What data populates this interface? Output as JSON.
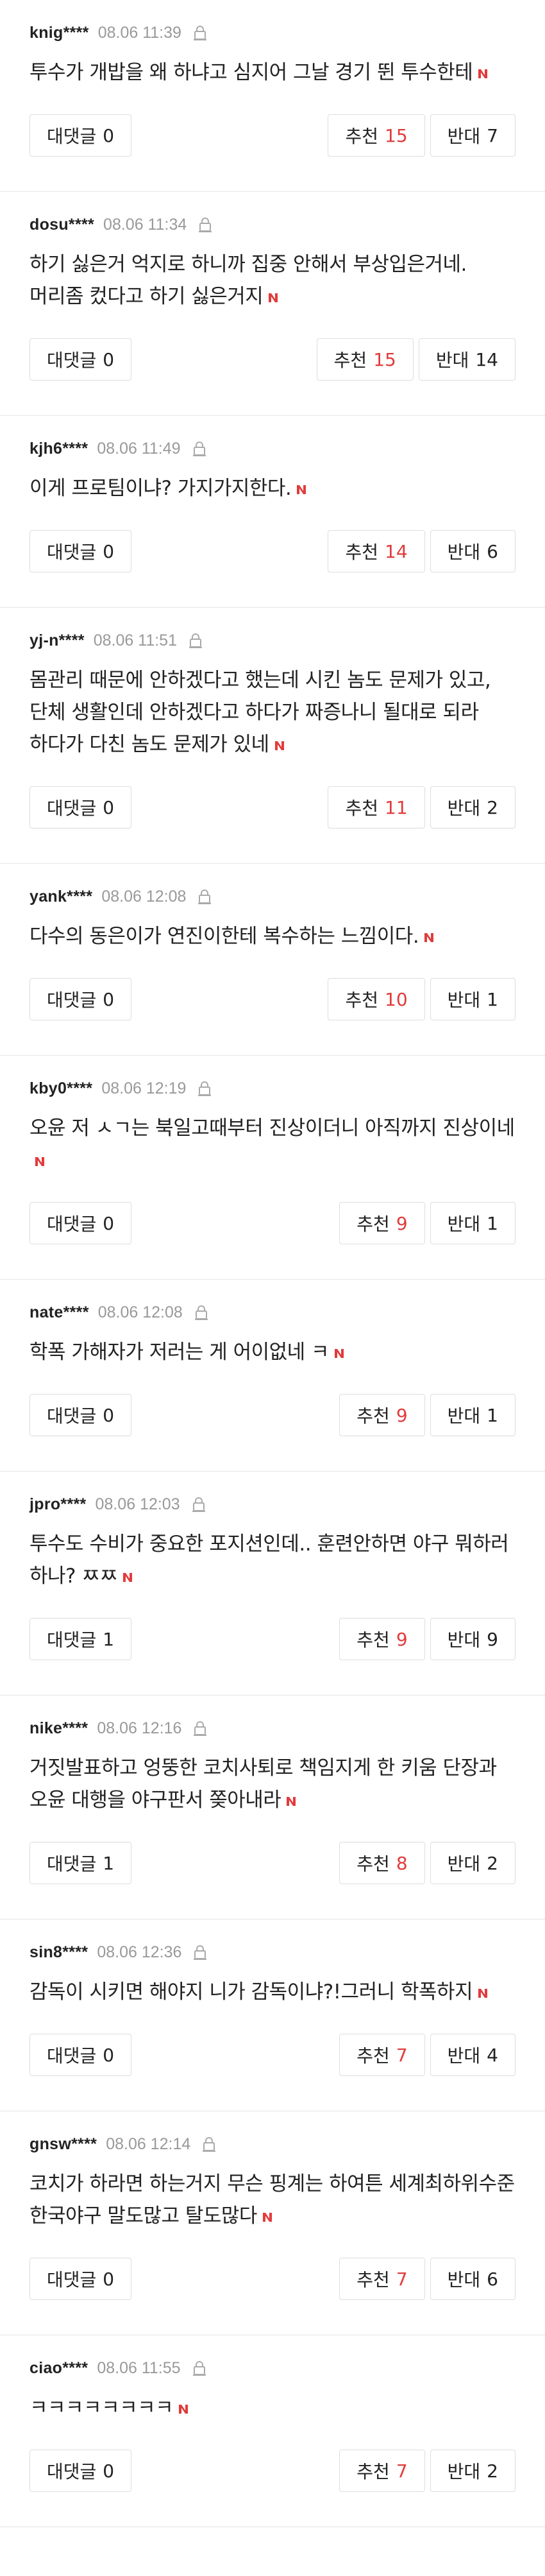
{
  "labels": {
    "reply": "대댓글",
    "recommend": "추천",
    "oppose": "반대"
  },
  "colors": {
    "new_badge": "#e23b3b",
    "recommend_count": "#e23b3b",
    "meta_gray": "#999999"
  },
  "comments": [
    {
      "nick": "knig****",
      "date": "08.06 11:39",
      "text": "투수가 개밥을 왜 하냐고 심지어 그날 경기 뛴 투수한테",
      "replies": "0",
      "recommend": "15",
      "oppose": "7"
    },
    {
      "nick": "dosu****",
      "date": "08.06 11:34",
      "text": "하기 싫은거 억지로 하니까 집중 안해서 부상입은거네. 머리좀 컸다고 하기 싫은거지",
      "replies": "0",
      "recommend": "15",
      "oppose": "14"
    },
    {
      "nick": "kjh6****",
      "date": "08.06 11:49",
      "text": "이게 프로팀이냐? 가지가지한다.",
      "replies": "0",
      "recommend": "14",
      "oppose": "6"
    },
    {
      "nick": "yj-n****",
      "date": "08.06 11:51",
      "text": "몸관리 때문에 안하겠다고 했는데 시킨 놈도 문제가 있고, 단체 생활인데 안하겠다고 하다가 짜증나니 될대로 되라 하다가 다친 놈도 문제가 있네",
      "replies": "0",
      "recommend": "11",
      "oppose": "2"
    },
    {
      "nick": "yank****",
      "date": "08.06 12:08",
      "text": "다수의 동은이가 연진이한테 복수하는 느낌이다.",
      "replies": "0",
      "recommend": "10",
      "oppose": "1"
    },
    {
      "nick": "kby0****",
      "date": "08.06 12:19",
      "text": "오윤 저 ㅅㄱ는 북일고때부터 진상이더니 아직까지 진상이네",
      "replies": "0",
      "recommend": "9",
      "oppose": "1"
    },
    {
      "nick": "nate****",
      "date": "08.06 12:08",
      "text": "학폭 가해자가 저러는 게 어이없네 ㅋ",
      "replies": "0",
      "recommend": "9",
      "oppose": "1"
    },
    {
      "nick": "jpro****",
      "date": "08.06 12:03",
      "text": "투수도 수비가 중요한 포지션인데.. 훈련안하면 야구 뭐하러 하나? ㅉㅉ",
      "replies": "1",
      "recommend": "9",
      "oppose": "9"
    },
    {
      "nick": "nike****",
      "date": "08.06 12:16",
      "text": "거짓발표하고 엉뚱한 코치사퇴로 책임지게 한 키움 단장과 오윤 대행을 야구판서 쫒아내라",
      "replies": "1",
      "recommend": "8",
      "oppose": "2"
    },
    {
      "nick": "sin8****",
      "date": "08.06 12:36",
      "text": "감독이 시키면 해야지 니가 감독이냐?!그러니 학폭하지",
      "replies": "0",
      "recommend": "7",
      "oppose": "4"
    },
    {
      "nick": "gnsw****",
      "date": "08.06 12:14",
      "text": "코치가 하라면 하는거지 무슨 핑계는 하여튼 세계최하위수준 한국야구 말도많고 탈도많다",
      "replies": "0",
      "recommend": "7",
      "oppose": "6"
    },
    {
      "nick": "ciao****",
      "date": "08.06 11:55",
      "text": "ㅋㅋㅋㅋㅋㅋㅋㅋ",
      "replies": "0",
      "recommend": "7",
      "oppose": "2"
    }
  ]
}
